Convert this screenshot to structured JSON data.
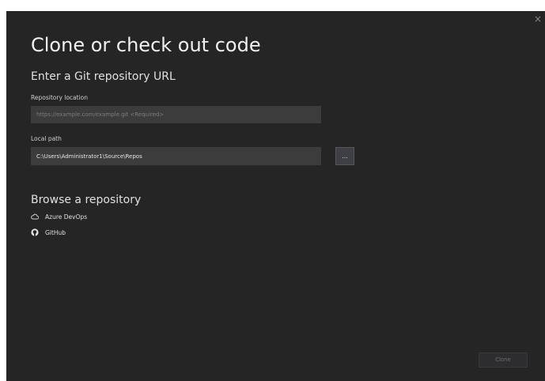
{
  "dialog": {
    "close_glyph": "×",
    "title": "Clone or check out code",
    "git_section": {
      "heading": "Enter a Git repository URL",
      "repo_label": "Repository location",
      "repo_placeholder": "https://example.com/example.git <Required>",
      "repo_value": "",
      "path_label": "Local path",
      "path_value": "C:\\Users\\Administrator1\\Source\\Repos",
      "browse_label": "..."
    },
    "browse_section": {
      "heading": "Browse a repository",
      "providers": [
        {
          "label": "Azure DevOps",
          "icon": "cloud-icon"
        },
        {
          "label": "GitHub",
          "icon": "github-icon"
        }
      ]
    },
    "clone_label": "Clone"
  },
  "colors": {
    "background": "#252526",
    "input_background": "#3c3c3c",
    "text": "#e6e6e6",
    "disabled_text": "#6d6d6d"
  }
}
